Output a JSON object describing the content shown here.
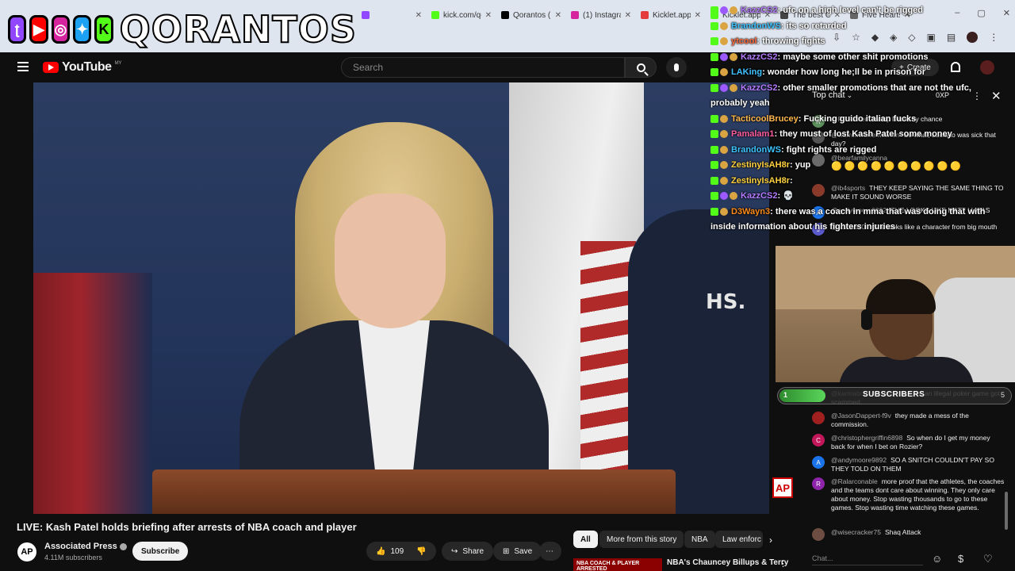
{
  "browser": {
    "tabs": [
      {
        "label": "",
        "color": "#9146ff"
      },
      {
        "label": "kick.com/qo",
        "color": "#53fc18"
      },
      {
        "label": "Qorantos (@",
        "color": "#000000"
      },
      {
        "label": "(1) Instagra",
        "color": "#d6249f"
      },
      {
        "label": "Kicklet.app",
        "color": "#e43c3c"
      },
      {
        "label": "Kicklet.app",
        "color": "#53fc18"
      },
      {
        "label": "The best Ch",
        "color": "#444444"
      },
      {
        "label": "Five Hearts",
        "color": "#666666"
      }
    ],
    "new_tab": "+",
    "minimize": "–",
    "maximize": "▢",
    "close": "✕"
  },
  "stream": {
    "brand": "QORANTOS"
  },
  "youtube": {
    "logo_text": "YouTube",
    "region": "MY",
    "search_placeholder": "Search",
    "create_label": "Create"
  },
  "video": {
    "title": "LIVE: Kash Patel holds briefing after arrests of NBA coach and player",
    "wall_text": "HS.",
    "ap_bug": "AP",
    "channel": {
      "name": "Associated Press",
      "subscribers": "4.11M subscribers",
      "avatar_text": "AP",
      "subscribe_label": "Subscribe"
    },
    "likes": "109",
    "share_label": "Share",
    "save_label": "Save",
    "chips": [
      "All",
      "More from this story",
      "NBA",
      "Law enforc"
    ],
    "recommended": {
      "thumb_text": "NBA COACH & PLAYER ARRESTED",
      "title": "NBA's Chauncey Billups & Terry"
    }
  },
  "kick_chat": [
    {
      "user": "KazzCS2",
      "text": ": ufc on a high level can't be rigged",
      "color": "#b57bff",
      "badges": [
        "k",
        "p",
        "g"
      ]
    },
    {
      "user": "BrandonWS",
      "text": ": its so retarded",
      "color": "#3ec3ff",
      "badges": [
        "k",
        "g"
      ]
    },
    {
      "user": "ytcool",
      "text": ": throwing fights",
      "color": "#ff6a3d",
      "badges": [
        "k",
        "g"
      ]
    },
    {
      "user": "KazzCS2",
      "text": ": maybe some other shit promotions",
      "color": "#b57bff",
      "badges": [
        "k",
        "p",
        "g"
      ]
    },
    {
      "user": "LAKing",
      "text": ": wonder how long he;ll be in prison for",
      "color": "#3ec3ff",
      "badges": [
        "k",
        "g"
      ]
    },
    {
      "user": "KazzCS2",
      "text": ": other smaller promotions that are not the ufc, probably yeah",
      "color": "#b57bff",
      "badges": [
        "k",
        "p",
        "g"
      ]
    },
    {
      "user": "TacticoolBrucey",
      "text": ": Fucking guido italian fucks",
      "color": "#ffb84d",
      "badges": [
        "k",
        "g"
      ]
    },
    {
      "user": "Pamalam1",
      "text": ": they must of lost Kash Patel some money",
      "color": "#ff5fa2",
      "badges": [
        "k",
        "g"
      ]
    },
    {
      "user": "BrandonWS",
      "text": ": fight rights are rigged",
      "color": "#3ec3ff",
      "badges": [
        "k",
        "g"
      ]
    },
    {
      "user": "ZestinyIsAH8r",
      "text": ": yup",
      "color": "#ffd23f",
      "badges": [
        "k",
        "g"
      ]
    },
    {
      "user": "ZestinyIsAH8r",
      "text": ":",
      "color": "#ffd23f",
      "badges": [
        "k",
        "g"
      ]
    },
    {
      "user": "KazzCS2",
      "text": ": 💀",
      "color": "#b57bff",
      "badges": [
        "k",
        "p",
        "g"
      ]
    },
    {
      "user": "D3Wayn3",
      "text": ": there was a coach in mma that was doing that with inside information about his fighters injuries",
      "color": "#ff8c1a",
      "badges": [
        "k",
        "g"
      ]
    }
  ],
  "yt_chat": {
    "header": "Top chat",
    "xp": "0XP",
    "messages_top": [
      {
        "author": "@RCFather",
        "text": "Trump linked by chance",
        "avatar": "R",
        "color": "#5b8f5b"
      },
      {
        "author": "@warrenwarrenwarren",
        "text": "So what, Luciano was sick that day?",
        "avatar": "",
        "color": "#555"
      },
      {
        "author": "@bearfamilycanna",
        "text": "",
        "avatar": "",
        "color": "#6a6a6a",
        "emoji": "🟡🟡🟡🟡🟡🟡🟡🟡🟡🟡"
      },
      {
        "author": "@ib4sports",
        "text": "THEY KEEP SAYING THE SAME THING TO MAKE IT SOUND WORSE",
        "avatar": "",
        "color": "#8a3a2a"
      },
      {
        "author": "@andymoore9892",
        "text": "SHE LOOKS LIKE MATT LUCAS",
        "avatar": "A",
        "color": "#1a73e8"
      },
      {
        "author": "@jason6704",
        "text": "She looks like a character from big mouth",
        "avatar": "J",
        "color": "#5a5acc"
      }
    ],
    "messages_bottom": [
      {
        "author": "@karmabolt",
        "text": "ole who attended an illegal poker game got scammed",
        "avatar": "",
        "color": "#777"
      },
      {
        "author": "@JasonDappert-f9v",
        "text": "they made a mess of the commission.",
        "avatar": "",
        "color": "#a02020"
      },
      {
        "author": "@christophergriffin6898",
        "text": "So when do I get my money back for when I bet on Rozier?",
        "avatar": "C",
        "color": "#c2185b"
      },
      {
        "author": "@andymoore9892",
        "text": "SO A SNITCH COULDN'T PAY SO THEY TOLD ON THEM",
        "avatar": "A",
        "color": "#1a73e8"
      },
      {
        "author": "@Ralarconable",
        "text": "more proof that the athletes, the coaches and the teams dont care about winning. They only care about money. Stop wasting thousands to go to these games. Stop wasting time watching these games.",
        "avatar": "R",
        "color": "#8e24aa"
      },
      {
        "author": "@wisecracker75",
        "text": "Shaq Attack",
        "avatar": "",
        "color": "#6d4c41"
      }
    ],
    "input_placeholder": "Chat..."
  },
  "sub_goal": {
    "current": "1",
    "label": "SUBSCRIBERS",
    "target": "5",
    "progress": 0.2
  }
}
